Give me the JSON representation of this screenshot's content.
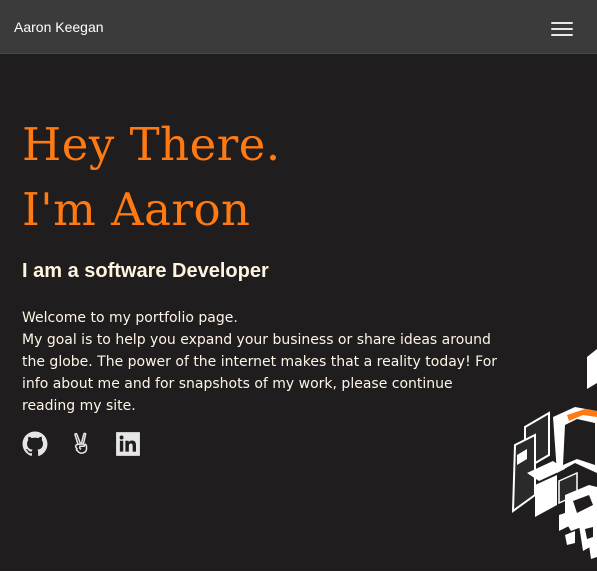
{
  "navbar": {
    "brand": "Aaron Keegan",
    "menu_icon": "hamburger-menu-icon"
  },
  "hero": {
    "title_line1": "Hey There.",
    "title_line2": "I'm Aaron",
    "subtitle": "I am a software Developer",
    "intro_lines": [
      "Welcome to my portfolio page.",
      "My goal is to help you expand your business or share ideas around the globe. The power of the internet makes that a reality today! For info about me and for snapshots of my work, please continue reading my site."
    ]
  },
  "socials": [
    {
      "icon": "github-icon"
    },
    {
      "icon": "angellist-icon"
    },
    {
      "icon": "linkedin-icon"
    }
  ],
  "colors": {
    "background": "#1f1d1d",
    "navbar": "#3b3b3b",
    "accent": "#ff7a12",
    "text": "#fff4e6"
  }
}
